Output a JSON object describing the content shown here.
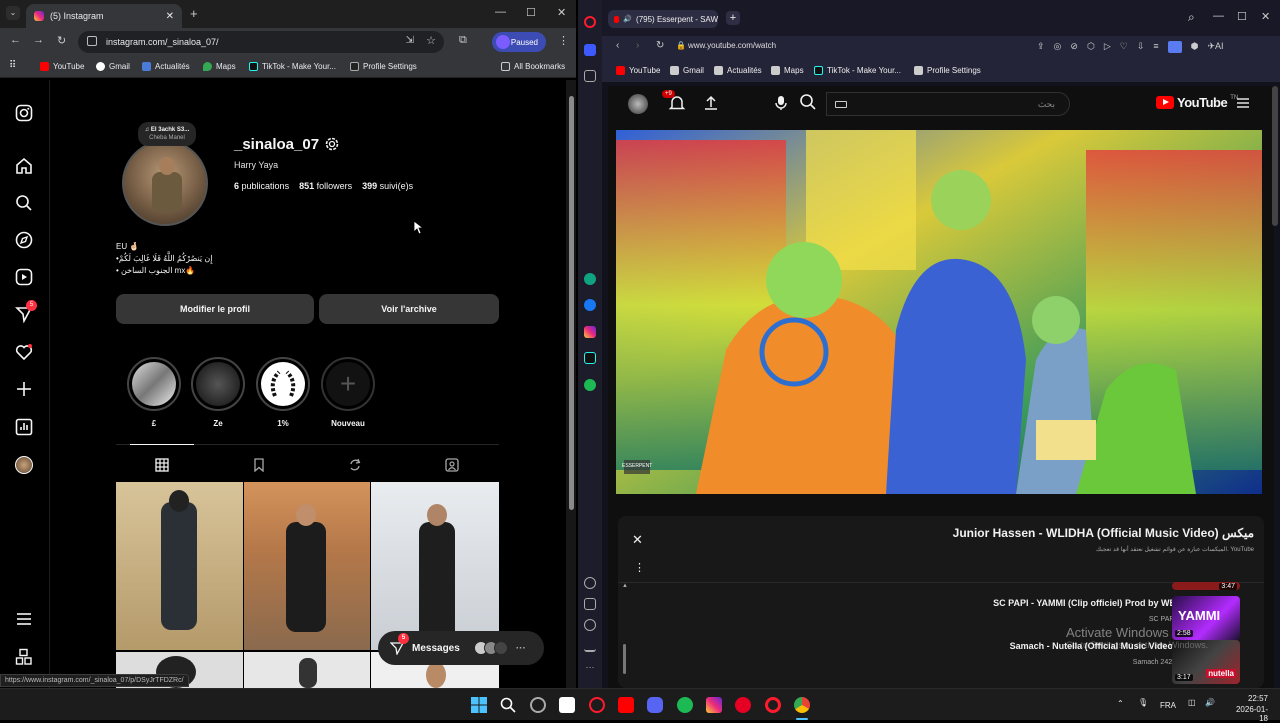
{
  "left_browser": {
    "tab_title": "(5) Instagram",
    "url": "instagram.com/_sinaloa_07/",
    "paused_label": "Paused",
    "bookmarks": [
      "YouTube",
      "Gmail",
      "Actualités",
      "Maps",
      "TikTok - Make Your...",
      "Profile Settings"
    ],
    "all_bookmarks": "All Bookmarks",
    "status_url": "https://www.instagram.com/_sinaloa_07/p/DSyJrTFDZRc/"
  },
  "instagram": {
    "notification_badge": "5",
    "note_line1": "♫ El 3achk S3...",
    "note_line2": "Cheba Manel",
    "username": "_sinaloa_07",
    "full_name": "Harry Yaya",
    "stats": {
      "publications_count": "6",
      "publications_label": "publications",
      "followers_count": "851",
      "followers_label": "followers",
      "following_count": "399",
      "following_label": "suivi(e)s"
    },
    "bio_line1": "EU 🤞🏻",
    "bio_line2": "•إِن يَنصُرْكُمُ اللَّهُ فَلَا غَالِبَ لَكُمْ",
    "bio_line3": "• الجنوب الساخن mx🔥",
    "edit_profile": "Modifier le profil",
    "view_archive": "Voir l'archive",
    "highlights": [
      "£",
      "Ze",
      "1%",
      "Nouveau"
    ],
    "messages_label": "Messages",
    "messages_badge": "5"
  },
  "right_browser": {
    "tab_title": "(795) Esserpent - SAW",
    "url": "www.youtube.com/watch",
    "ai_label": "AI",
    "bookmarks": [
      "YouTube",
      "Gmail",
      "Actualités",
      "Maps",
      "TikTok - Make Your...",
      "Profile Settings"
    ]
  },
  "youtube": {
    "notif_badge": "+9",
    "search_placeholder": "بحث",
    "logo_text": "YouTube",
    "logo_region": "TN",
    "mix_title": "Junior Hassen - WLIDHA (Official Music Video) ميكس",
    "mix_subtitle": "الميكسات عبارة عن قوائم تشغيل نعتقد أنها قد تعجبك. YouTube",
    "recommendations": [
      {
        "title": "SC PAPI - YAMMI (Clip officiel) Prod by WB",
        "channel": "SC PAPI",
        "duration": "2:58",
        "thumb_text": "YAMMI"
      },
      {
        "title": "Samach - Nutella (Official Music Video)",
        "channel": "Samach 2424",
        "duration": "3:17",
        "thumb_text": "nutella"
      }
    ],
    "prev_duration": "3:47",
    "video_overlay_text": "ESSERPENT"
  },
  "windows": {
    "watermark_line1": "Activate Windows",
    "watermark_line2": "Go to Settings to activate Windows.",
    "language": "FRA",
    "time": "22:57",
    "date": "2026-01-18"
  },
  "colors": {
    "ig_bg": "#000000",
    "button_bg": "#363636",
    "opera_bg": "#181826",
    "youtube_red": "#ff0000",
    "paused_blue": "#3c4cb4"
  }
}
